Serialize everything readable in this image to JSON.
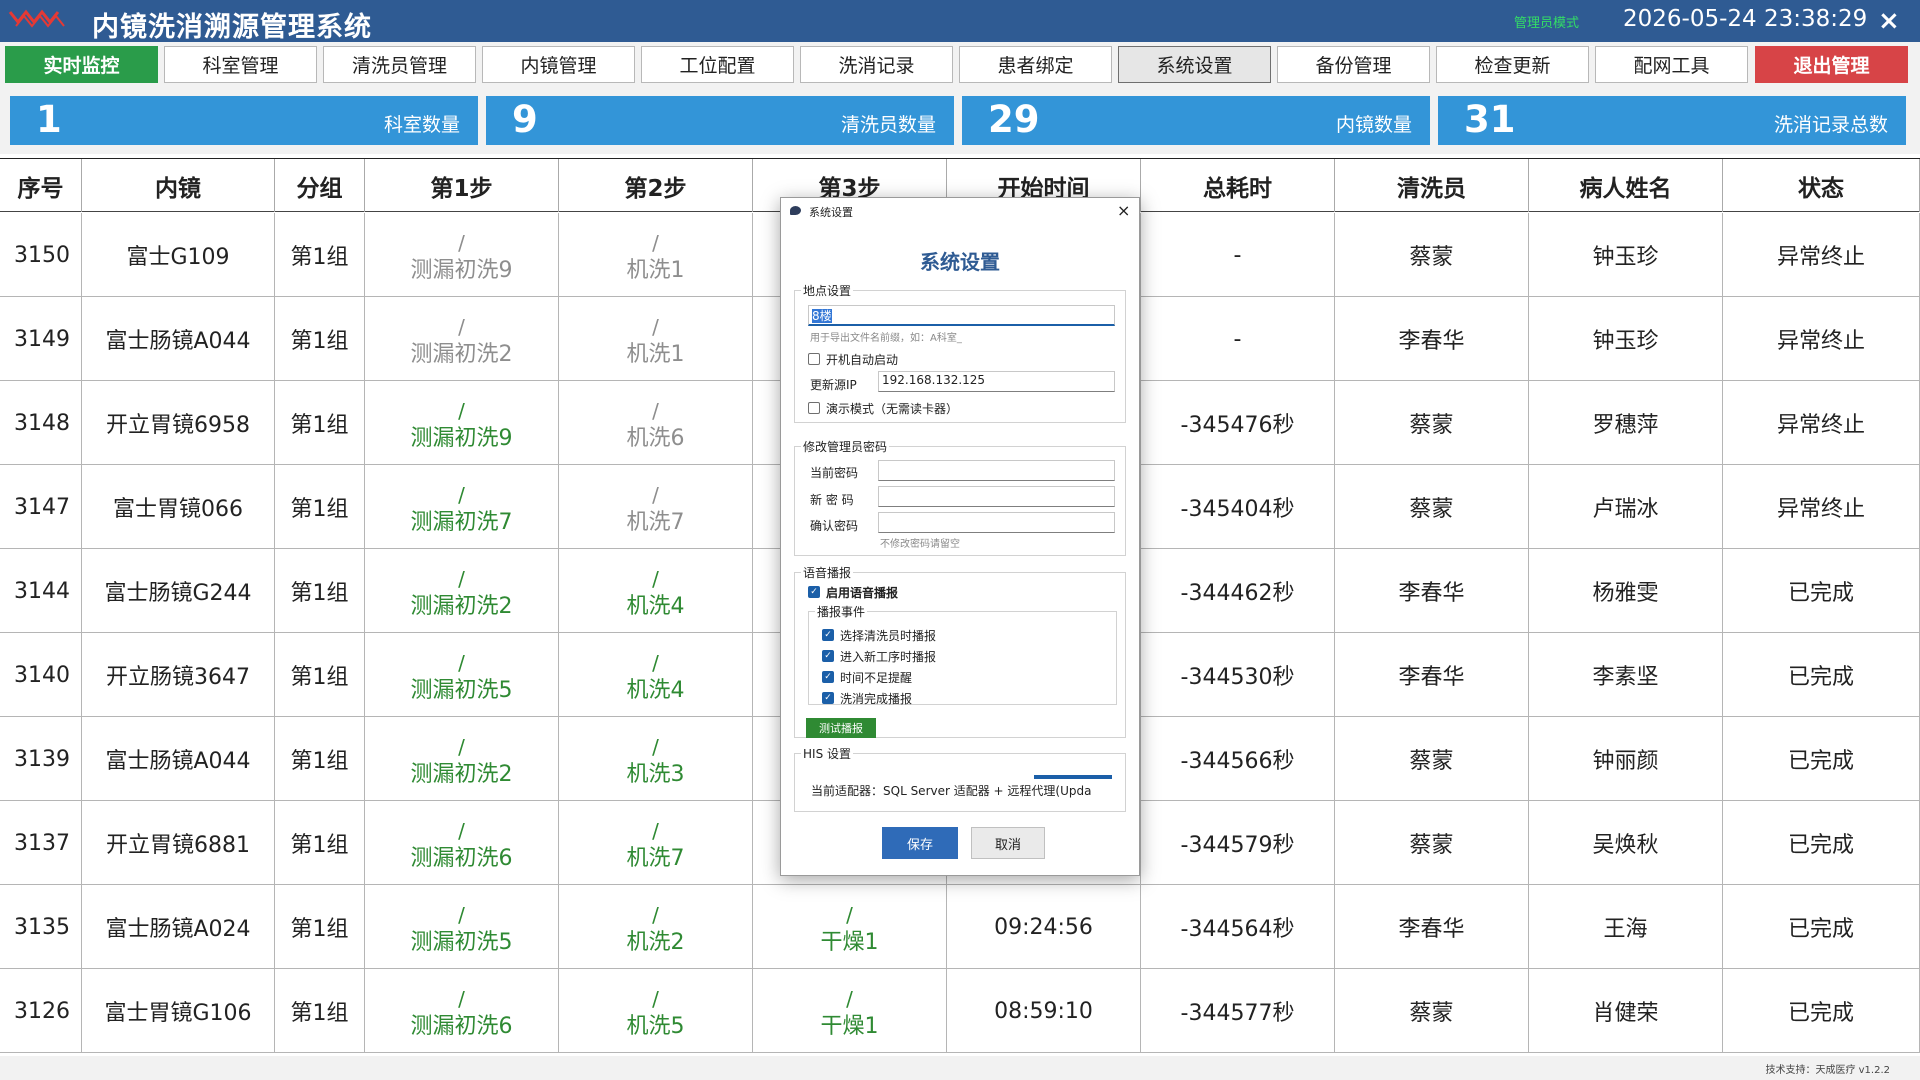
{
  "app": {
    "title": "内镜洗消溯源管理系统",
    "mode": "管理员模式",
    "datetime": "2026-05-24 23:38:29",
    "close_glyph": "×"
  },
  "nav": [
    {
      "label": "实时监控",
      "state": "active"
    },
    {
      "label": "科室管理",
      "state": "normal"
    },
    {
      "label": "清洗员管理",
      "state": "normal"
    },
    {
      "label": "内镜管理",
      "state": "normal"
    },
    {
      "label": "工位配置",
      "state": "normal"
    },
    {
      "label": "洗消记录",
      "state": "normal"
    },
    {
      "label": "患者绑定",
      "state": "normal"
    },
    {
      "label": "系统设置",
      "state": "pressed"
    },
    {
      "label": "备份管理",
      "state": "normal"
    },
    {
      "label": "检查更新",
      "state": "normal"
    },
    {
      "label": "配网工具",
      "state": "normal"
    },
    {
      "label": "退出管理",
      "state": "danger"
    }
  ],
  "stats": [
    {
      "value": "1",
      "label": "科室数量"
    },
    {
      "value": "9",
      "label": "清洗员数量"
    },
    {
      "value": "29",
      "label": "内镜数量"
    },
    {
      "value": "31",
      "label": "洗消记录总数"
    }
  ],
  "table": {
    "headers": [
      "序号",
      "内镜",
      "分组",
      "第1步",
      "第2步",
      "第3步",
      "开始时间",
      "总耗时",
      "清洗员",
      "病人姓名",
      "状态"
    ],
    "rows": [
      {
        "id": "3150",
        "scope": "富士G109",
        "group": "第1组",
        "s1": {
          "slash": "/",
          "name": "测漏初洗9",
          "done": false
        },
        "s2": {
          "slash": "/",
          "name": "机洗1",
          "done": false
        },
        "s3": null,
        "start": "",
        "duration": "-",
        "washer": "蔡蒙",
        "patient": "钟玉珍",
        "status": "异常终止"
      },
      {
        "id": "3149",
        "scope": "富士肠镜A044",
        "group": "第1组",
        "s1": {
          "slash": "/",
          "name": "测漏初洗2",
          "done": false
        },
        "s2": {
          "slash": "/",
          "name": "机洗1",
          "done": false
        },
        "s3": null,
        "start": "",
        "duration": "-",
        "washer": "李春华",
        "patient": "钟玉珍",
        "status": "异常终止"
      },
      {
        "id": "3148",
        "scope": "开立胃镜6958",
        "group": "第1组",
        "s1": {
          "slash": "/",
          "name": "测漏初洗9",
          "done": true
        },
        "s2": {
          "slash": "/",
          "name": "机洗6",
          "done": false
        },
        "s3": null,
        "start": "",
        "duration": "-345476秒",
        "washer": "蔡蒙",
        "patient": "罗穗萍",
        "status": "异常终止"
      },
      {
        "id": "3147",
        "scope": "富士胃镜066",
        "group": "第1组",
        "s1": {
          "slash": "/",
          "name": "测漏初洗7",
          "done": true
        },
        "s2": {
          "slash": "/",
          "name": "机洗7",
          "done": false
        },
        "s3": null,
        "start": "",
        "duration": "-345404秒",
        "washer": "蔡蒙",
        "patient": "卢瑞冰",
        "status": "异常终止"
      },
      {
        "id": "3144",
        "scope": "富士肠镜G244",
        "group": "第1组",
        "s1": {
          "slash": "/",
          "name": "测漏初洗2",
          "done": true
        },
        "s2": {
          "slash": "/",
          "name": "机洗4",
          "done": true
        },
        "s3": null,
        "start": "",
        "duration": "-344462秒",
        "washer": "李春华",
        "patient": "杨雅雯",
        "status": "已完成"
      },
      {
        "id": "3140",
        "scope": "开立肠镜3647",
        "group": "第1组",
        "s1": {
          "slash": "/",
          "name": "测漏初洗5",
          "done": true
        },
        "s2": {
          "slash": "/",
          "name": "机洗4",
          "done": true
        },
        "s3": null,
        "start": "",
        "duration": "-344530秒",
        "washer": "李春华",
        "patient": "李素坚",
        "status": "已完成"
      },
      {
        "id": "3139",
        "scope": "富士肠镜A044",
        "group": "第1组",
        "s1": {
          "slash": "/",
          "name": "测漏初洗2",
          "done": true
        },
        "s2": {
          "slash": "/",
          "name": "机洗3",
          "done": true
        },
        "s3": null,
        "start": "",
        "duration": "-344566秒",
        "washer": "蔡蒙",
        "patient": "钟丽颜",
        "status": "已完成"
      },
      {
        "id": "3137",
        "scope": "开立胃镜6881",
        "group": "第1组",
        "s1": {
          "slash": "/",
          "name": "测漏初洗6",
          "done": true
        },
        "s2": {
          "slash": "/",
          "name": "机洗7",
          "done": true
        },
        "s3": null,
        "start": "",
        "duration": "-344579秒",
        "washer": "蔡蒙",
        "patient": "吴焕秋",
        "status": "已完成"
      },
      {
        "id": "3135",
        "scope": "富士肠镜A024",
        "group": "第1组",
        "s1": {
          "slash": "/",
          "name": "测漏初洗5",
          "done": true
        },
        "s2": {
          "slash": "/",
          "name": "机洗2",
          "done": true
        },
        "s3": {
          "slash": "/",
          "name": "干燥1",
          "done": true
        },
        "start": "09:24:56",
        "duration": "-344564秒",
        "washer": "李春华",
        "patient": "王海",
        "status": "已完成"
      },
      {
        "id": "3126",
        "scope": "富士胃镜G106",
        "group": "第1组",
        "s1": {
          "slash": "/",
          "name": "测漏初洗6",
          "done": true
        },
        "s2": {
          "slash": "/",
          "name": "机洗5",
          "done": true
        },
        "s3": {
          "slash": "/",
          "name": "干燥1",
          "done": true
        },
        "start": "08:59:10",
        "duration": "-344577秒",
        "washer": "蔡蒙",
        "patient": "肖健荣",
        "status": "已完成"
      }
    ]
  },
  "footer": {
    "text": "技术支持：天成医疗 v1.2.2"
  },
  "dialog": {
    "window_title": "系统设置",
    "heading": "系统设置",
    "close_glyph": "×",
    "location": {
      "legend": "地点设置",
      "value": "8楼",
      "hint": "用于导出文件名前缀，如：A科室_",
      "autostart_label": "开机自动启动",
      "autostart_checked": false,
      "update_ip_label": "更新源IP",
      "update_ip_value": "192.168.132.125",
      "demo_label": "演示模式（无需读卡器）",
      "demo_checked": false
    },
    "password": {
      "legend": "修改管理员密码",
      "current_label": "当前密码",
      "new_label": "新 密 码",
      "confirm_label": "确认密码",
      "hint": "不修改密码请留空"
    },
    "voice": {
      "legend": "语音播报",
      "enable_label": "启用语音播报",
      "enable_checked": true,
      "events_legend": "播报事件",
      "events": [
        {
          "label": "选择清洗员时播报",
          "checked": true
        },
        {
          "label": "进入新工序时播报",
          "checked": true
        },
        {
          "label": "时间不足提醒",
          "checked": true
        },
        {
          "label": "洗消完成播报",
          "checked": true
        }
      ],
      "test_button": "测试播报"
    },
    "his": {
      "legend": "HIS 设置",
      "adapter_text": "当前适配器：SQL Server 适配器 + 远程代理(Upda"
    },
    "save_button": "保存",
    "cancel_button": "取消",
    "check_glyph": "✓"
  },
  "colors": {
    "titlebar": "#2f5b93",
    "active": "#2a9c4a",
    "danger": "#d74447",
    "stat": "#3395d8",
    "done_step": "#2f8a33",
    "pending_step": "#8e8e8e"
  }
}
